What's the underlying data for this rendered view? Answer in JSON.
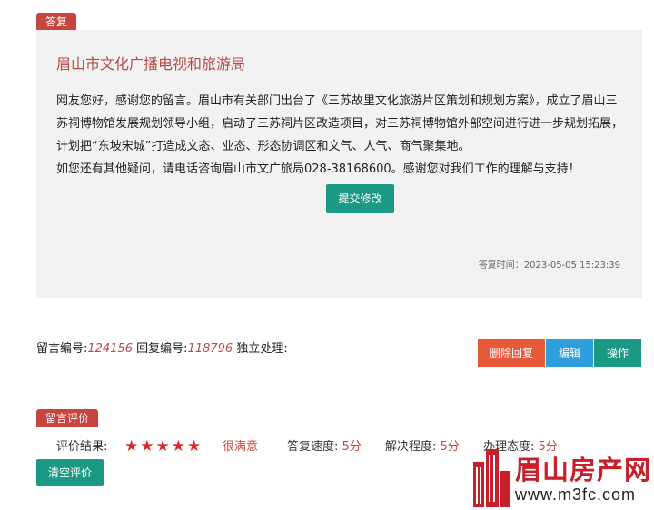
{
  "reply": {
    "tag": "答复",
    "org": "眉山市文化广播电视和旅游局",
    "paragraph1": "网友您好，感谢您的留言。眉山市有关部门出台了《三苏故里文化旅游片区策划和规划方案》，成立了眉山三苏祠博物馆发展规划领导小组，启动了三苏祠片区改造项目，对三苏祠博物馆外部空间进行进一步规划拓展，计划把“东坡宋城”打造成文态、业态、形态协调区和文气、人气、商气聚集地。",
    "paragraph2": "如您还有其他疑问，请电话咨询眉山市文广旅局028-38168600。感谢您对我们工作的理解与支持！",
    "submit_label": "提交修改",
    "time_label": "答复时间：",
    "time_value": "2023-05-05 15:23:39"
  },
  "meta": {
    "msg_no_label": "留言编号:",
    "msg_no": "124156",
    "reply_no_label": "回复编号:",
    "reply_no": "118796",
    "handling": "独立处理:"
  },
  "actions": {
    "delete_label": "删除回复",
    "edit_label": "编辑",
    "operate_label": "操作"
  },
  "evaluation": {
    "tag": "留言评价",
    "result_label": "评价结果:",
    "stars": "★★★★★",
    "rating": 5,
    "rating_text": "很满意",
    "speed_label": "答复速度:",
    "speed_value": "5分",
    "resolve_label": "解决程度:",
    "resolve_value": "5分",
    "attitude_label": "办理态度:",
    "attitude_value": "5分",
    "clear_label": "清空评价"
  },
  "watermark": {
    "name": "眉山房产网",
    "url": "www.m3fc.com"
  },
  "colors": {
    "accent_red": "#c8453e",
    "teal": "#1a9a84",
    "orange": "#e8593a",
    "blue": "#2e9fdc"
  }
}
